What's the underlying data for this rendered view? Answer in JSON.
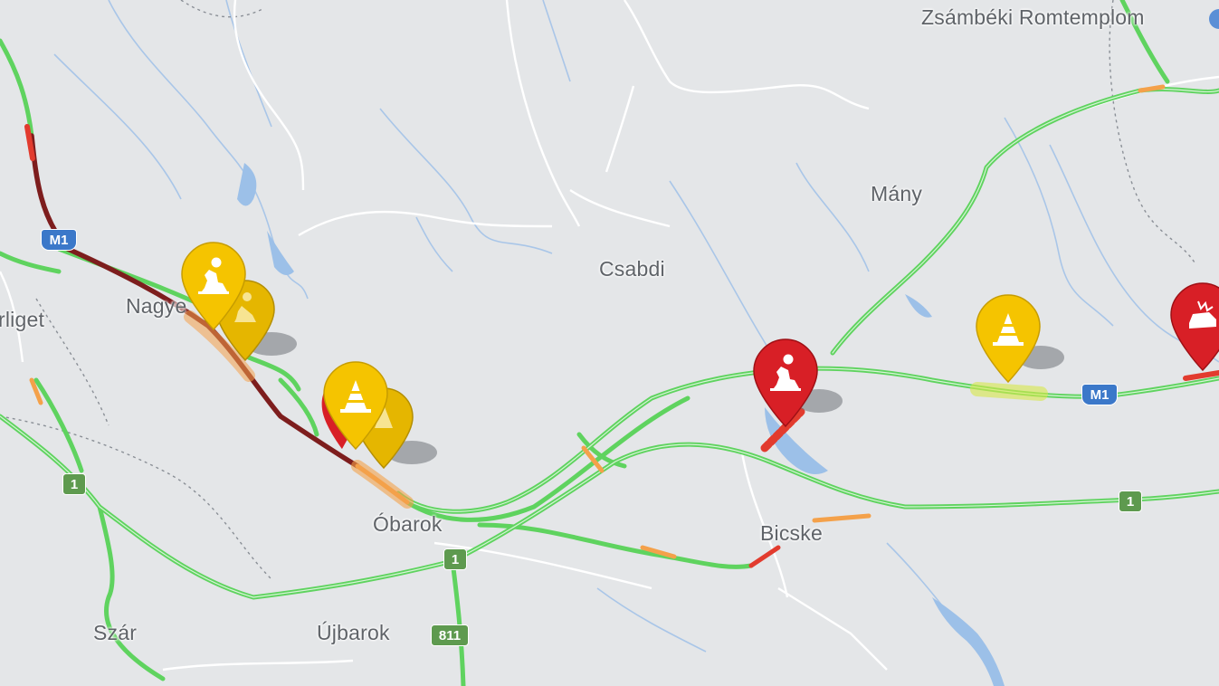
{
  "map": {
    "labels": [
      {
        "id": "zsambeki",
        "text": "Zsámbéki Romtemplom"
      },
      {
        "id": "many",
        "text": "Mány"
      },
      {
        "id": "csabdi",
        "text": "Csabdi"
      },
      {
        "id": "nagyegyhaza",
        "text": "Nagye"
      },
      {
        "id": "liget",
        "text": "rliget"
      },
      {
        "id": "obarok",
        "text": "Óbarok"
      },
      {
        "id": "bicske",
        "text": "Bicske"
      },
      {
        "id": "szar",
        "text": "Szár"
      },
      {
        "id": "ujbarok",
        "text": "Újbarok"
      }
    ],
    "shields": [
      {
        "id": "m1-west",
        "text": "M1",
        "kind": "motorway"
      },
      {
        "id": "m1-east",
        "text": "M1",
        "kind": "motorway"
      },
      {
        "id": "r1-west",
        "text": "1",
        "kind": "main"
      },
      {
        "id": "r1-mid",
        "text": "1",
        "kind": "main"
      },
      {
        "id": "r1-east",
        "text": "1",
        "kind": "main"
      },
      {
        "id": "r811",
        "text": "811",
        "kind": "main"
      }
    ],
    "markers": [
      {
        "id": "roadworks-nagyegyhaza-1",
        "icon": "roadworks-icon",
        "color": "#f5c400"
      },
      {
        "id": "roadworks-nagyegyhaza-2",
        "icon": "roadworks-icon",
        "color": "#f5c400"
      },
      {
        "id": "cone-obarok-1",
        "icon": "traffic-cone-icon",
        "color": "#f5c400"
      },
      {
        "id": "cone-obarok-2",
        "icon": "traffic-cone-icon",
        "color": "#f5c400"
      },
      {
        "id": "roadworks-bicske",
        "icon": "roadworks-icon",
        "color": "#d81f26"
      },
      {
        "id": "cone-many",
        "icon": "traffic-cone-icon",
        "color": "#f5c400"
      },
      {
        "id": "accident-east",
        "icon": "car-crash-icon",
        "color": "#d81f26"
      }
    ],
    "colors": {
      "background": "#e4e6e8",
      "traffic_free": "#5fd35f",
      "traffic_slow": "#f4a14a",
      "traffic_jam": "#e23b2e",
      "traffic_stopped": "#7d1d1d",
      "water": "#9cc0e8",
      "minor_road": "#ffffff"
    }
  }
}
